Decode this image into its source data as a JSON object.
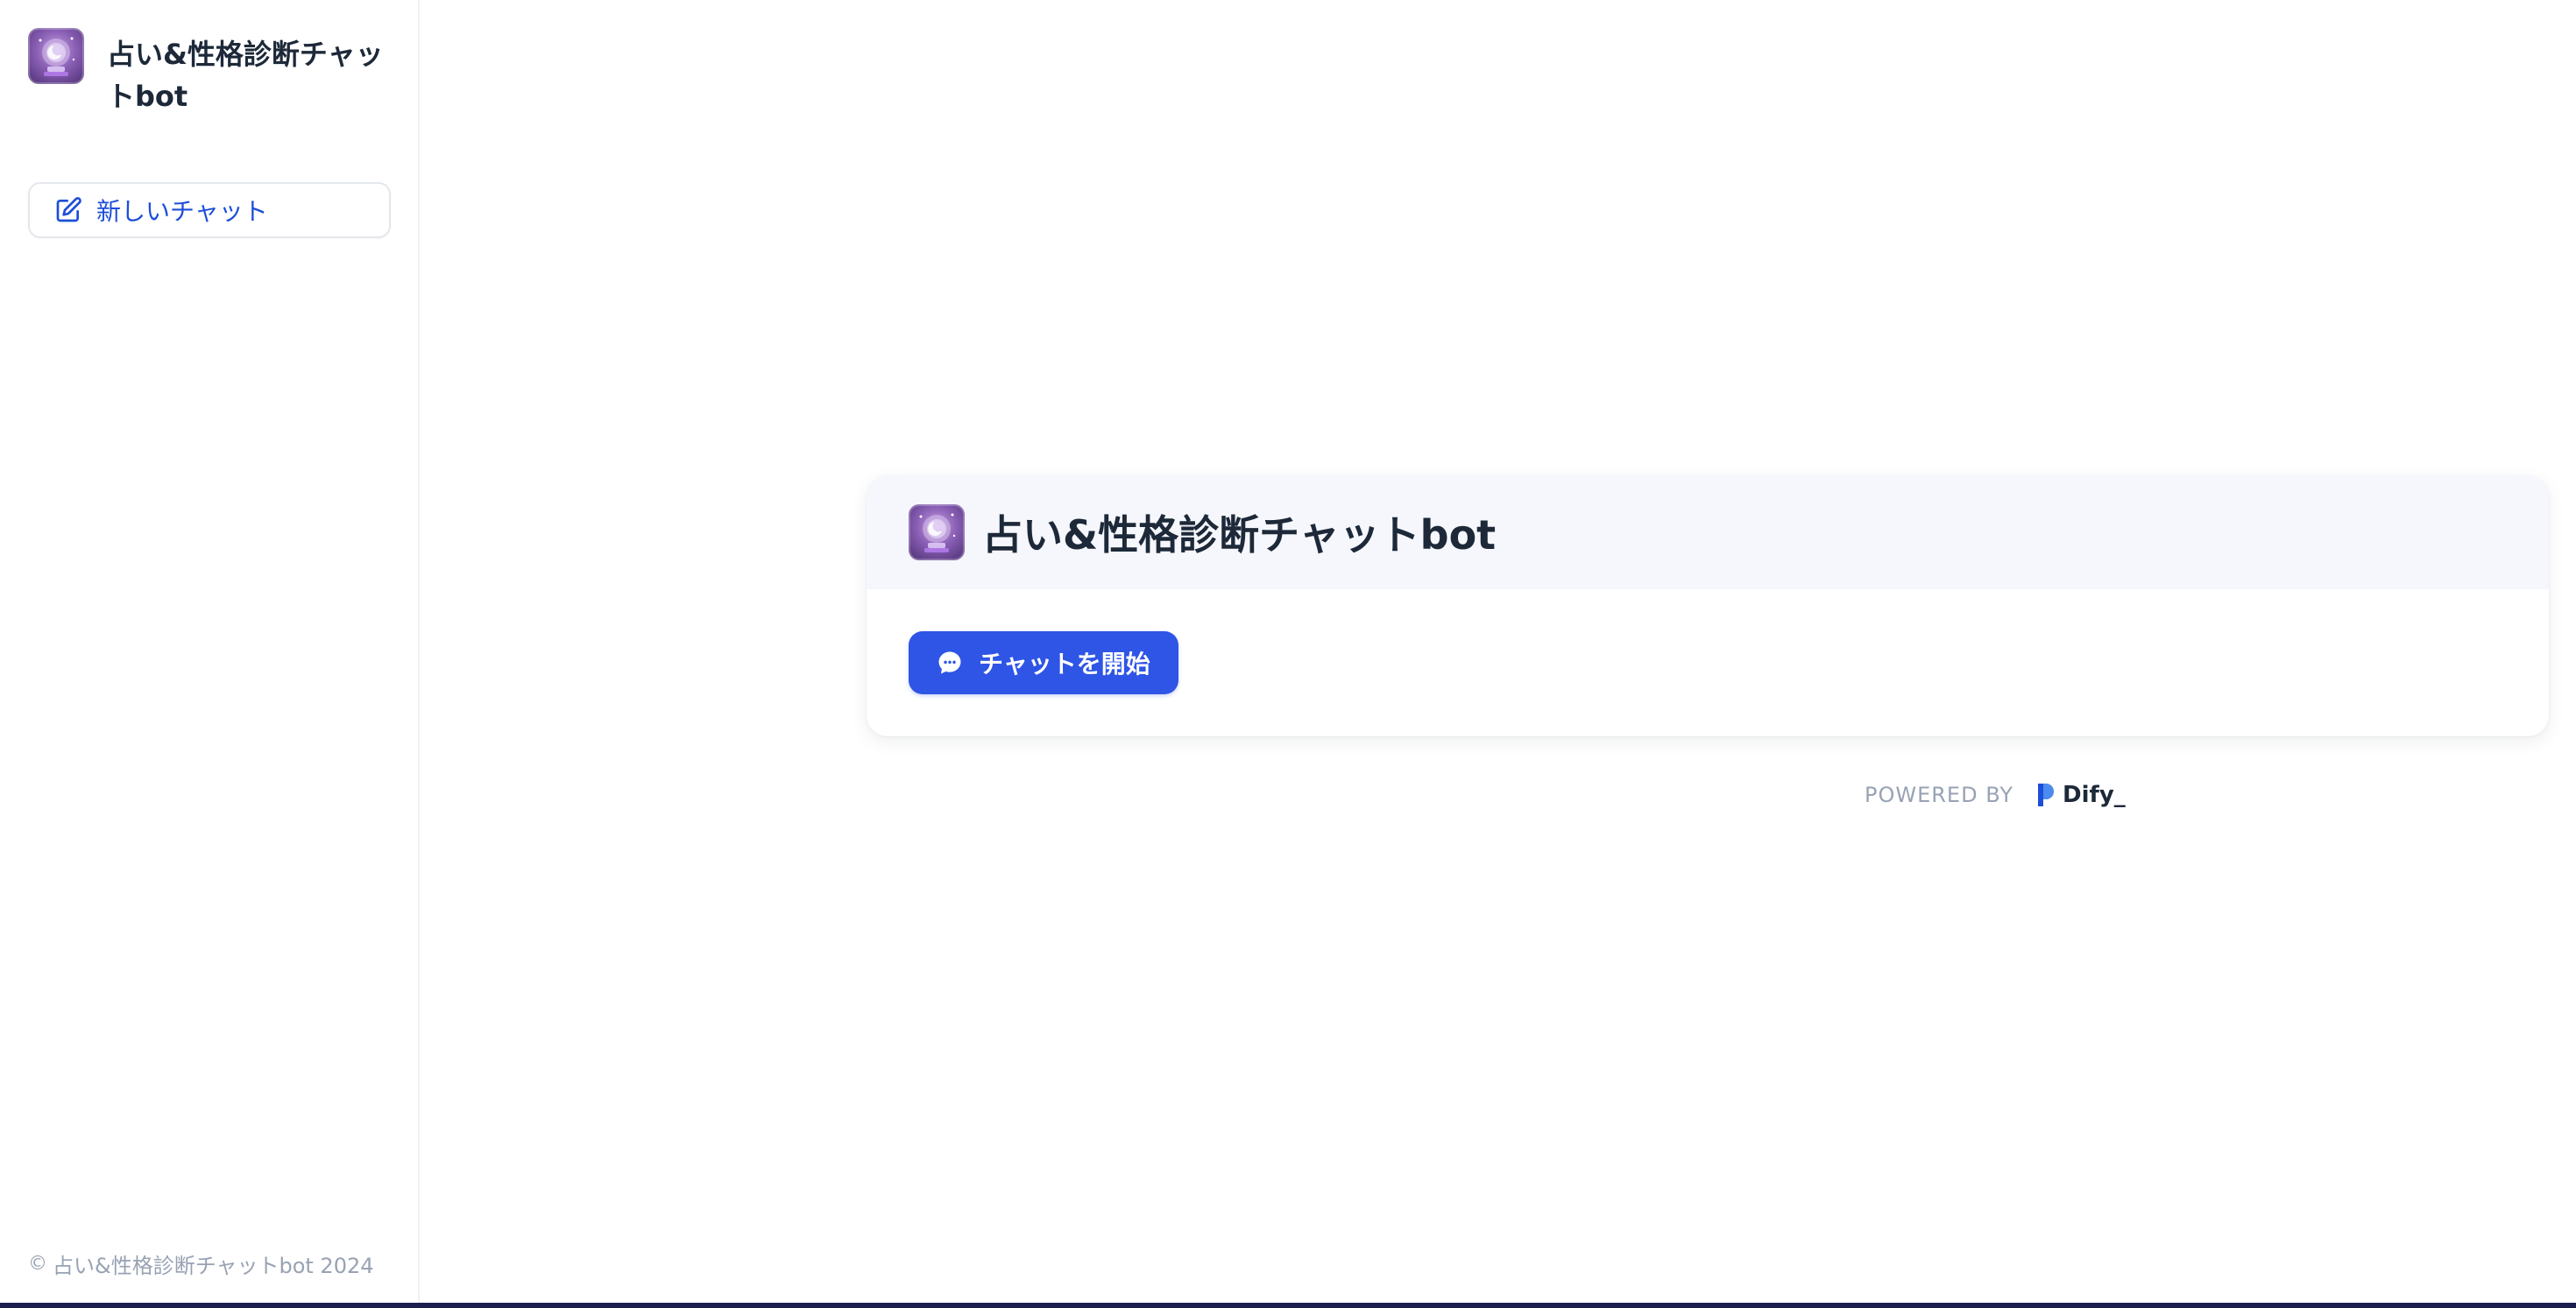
{
  "app": {
    "title": "占い&性格診断チャットbot",
    "icon": "crystal-ball-icon"
  },
  "sidebar": {
    "title": "占い&性格診断チャットbot",
    "new_chat_label": "新しいチャット",
    "new_chat_icon": "edit-icon",
    "copyright_symbol": "©",
    "copyright_text": "占い&性格診断チャットbot 2024"
  },
  "main": {
    "card_title": "占い&性格診断チャットbot",
    "start_button_label": "チャットを開始",
    "start_button_icon": "chat-bubble-icon",
    "powered_by_label": "POWERED BY",
    "powered_by_brand": "Dify"
  },
  "colors": {
    "accent": "#2e55e6",
    "link": "#155eef",
    "text_primary": "#1d2939",
    "text_muted": "#98a2b3",
    "card_header_bg": "#f5f7fc"
  }
}
